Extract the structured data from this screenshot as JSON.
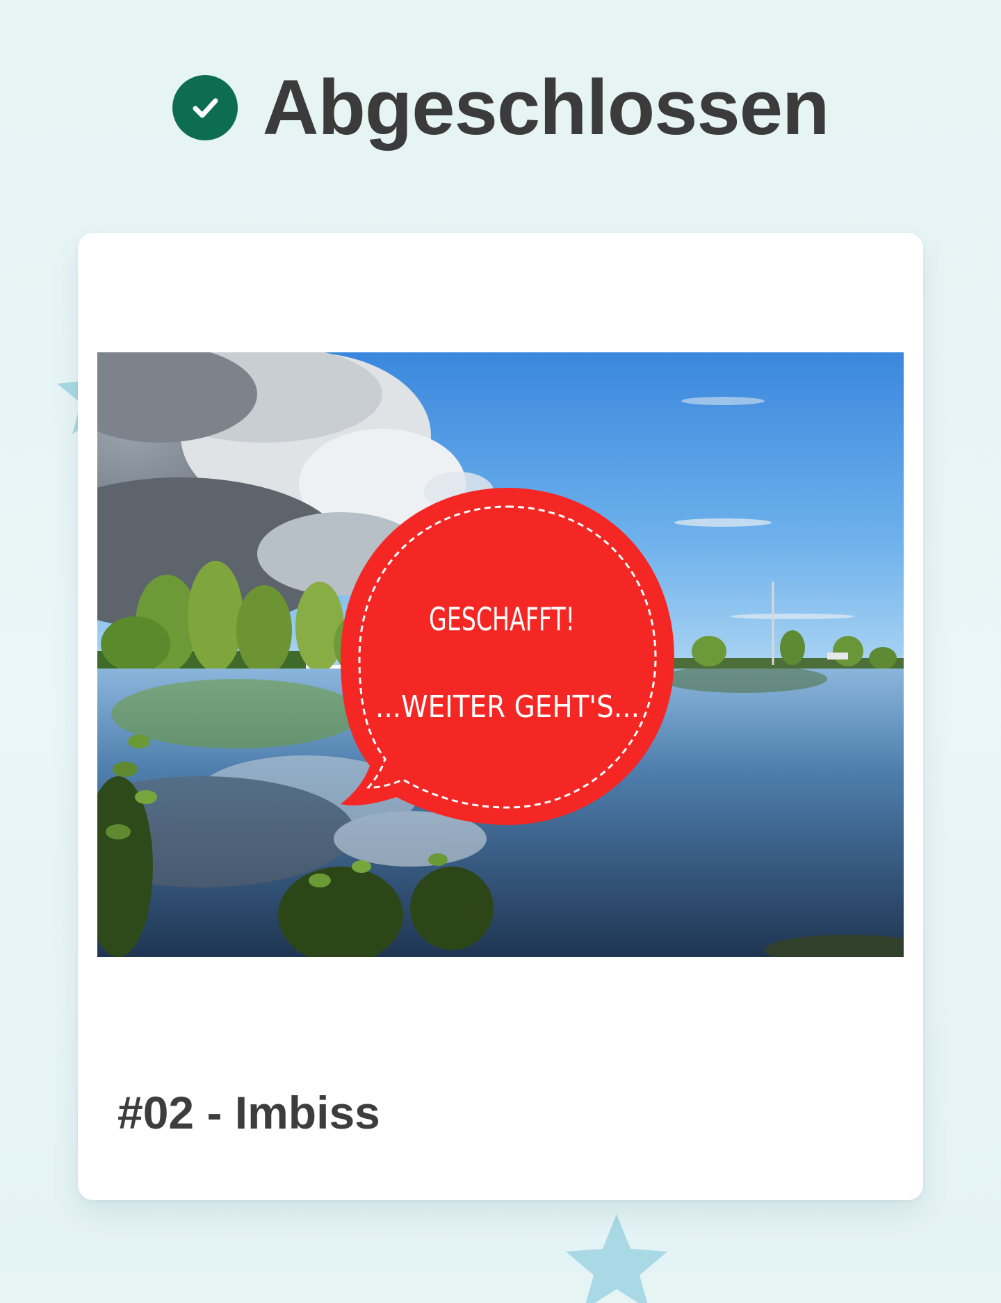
{
  "header": {
    "status_icon": "check-circle-icon",
    "title": "Abgeschlossen"
  },
  "card": {
    "image": {
      "alt": "lake-landscape-photo",
      "bubble_line1": "GESCHAFFT!",
      "bubble_line2": "...WEITER GEHT'S..."
    },
    "title": "#02 - Imbiss"
  },
  "colors": {
    "check_green": "#0c6e4f",
    "bubble_red": "#f42724",
    "star_blue": "#a7d8e4",
    "background": "#e6f4f4"
  }
}
